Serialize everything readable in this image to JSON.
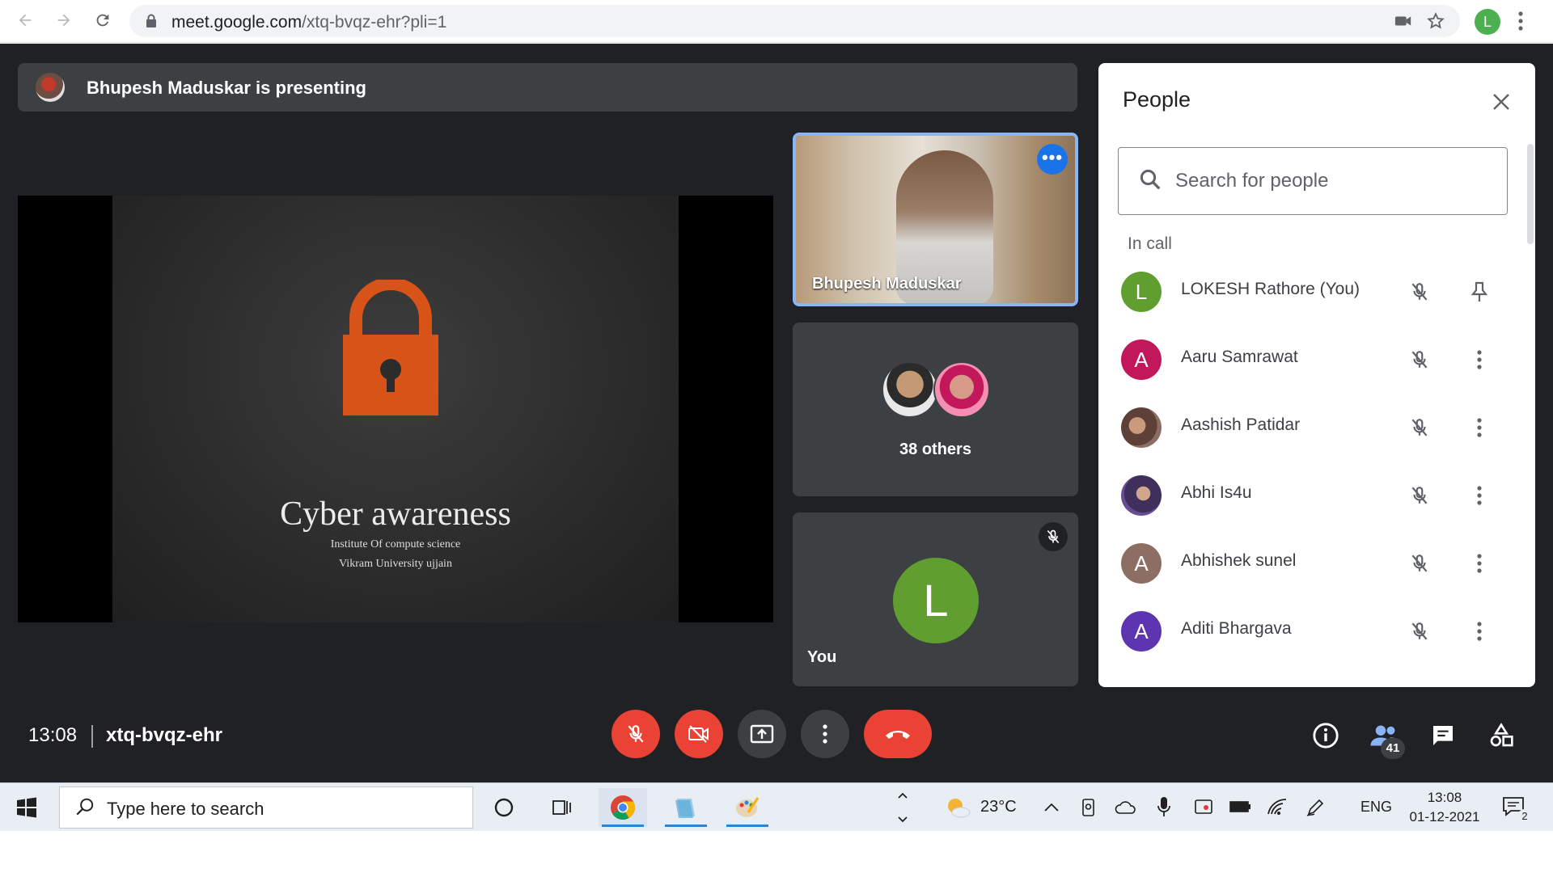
{
  "browser": {
    "url_main": "meet.google.com",
    "url_path": "/xtq-bvqz-ehr?pli=1",
    "profile_initial": "L"
  },
  "meet": {
    "presenting_text": "Bhupesh Maduskar is presenting",
    "slide": {
      "title": "Cyber awareness",
      "subtitle1": "Institute Of compute science",
      "subtitle2": "Vikram University ujjain",
      "lock_color": "#d85318"
    },
    "tiles": {
      "presenter_name": "Bhupesh Maduskar",
      "others_label": "38 others",
      "self_label": "You",
      "self_initial": "L"
    },
    "bottom": {
      "time": "13:08",
      "meeting_code": "xtq-bvqz-ehr",
      "participant_count": "41"
    },
    "colors": {
      "end_call_red": "#ea4335",
      "accent_blue": "#8ab4f8"
    }
  },
  "people_panel": {
    "title": "People",
    "search_placeholder": "Search for people",
    "section_label": "In call",
    "participants": [
      {
        "initial": "L",
        "name": "LOKESH Rathore (You)",
        "color": "#5f9e2f",
        "action": "pin-icon"
      },
      {
        "initial": "A",
        "name": "Aaru Samrawat",
        "color": "#c2185b",
        "action": "more-vert-icon"
      },
      {
        "initial": "",
        "name": "Aashish Patidar",
        "color": "#5d4037",
        "action": "more-vert-icon"
      },
      {
        "initial": "",
        "name": "Abhi Is4u",
        "color": "#6a4c93",
        "action": "more-vert-icon"
      },
      {
        "initial": "A",
        "name": "Abhishek sunel",
        "color": "#8d6e63",
        "action": "more-vert-icon"
      },
      {
        "initial": "A",
        "name": "Aditi Bhargava",
        "color": "#5e35b1",
        "action": "more-vert-icon"
      }
    ]
  },
  "taskbar": {
    "search_placeholder": "Type here to search",
    "temperature": "23°C",
    "language": "ENG",
    "time": "13:08",
    "date": "01-12-2021",
    "notification_count": "2"
  }
}
